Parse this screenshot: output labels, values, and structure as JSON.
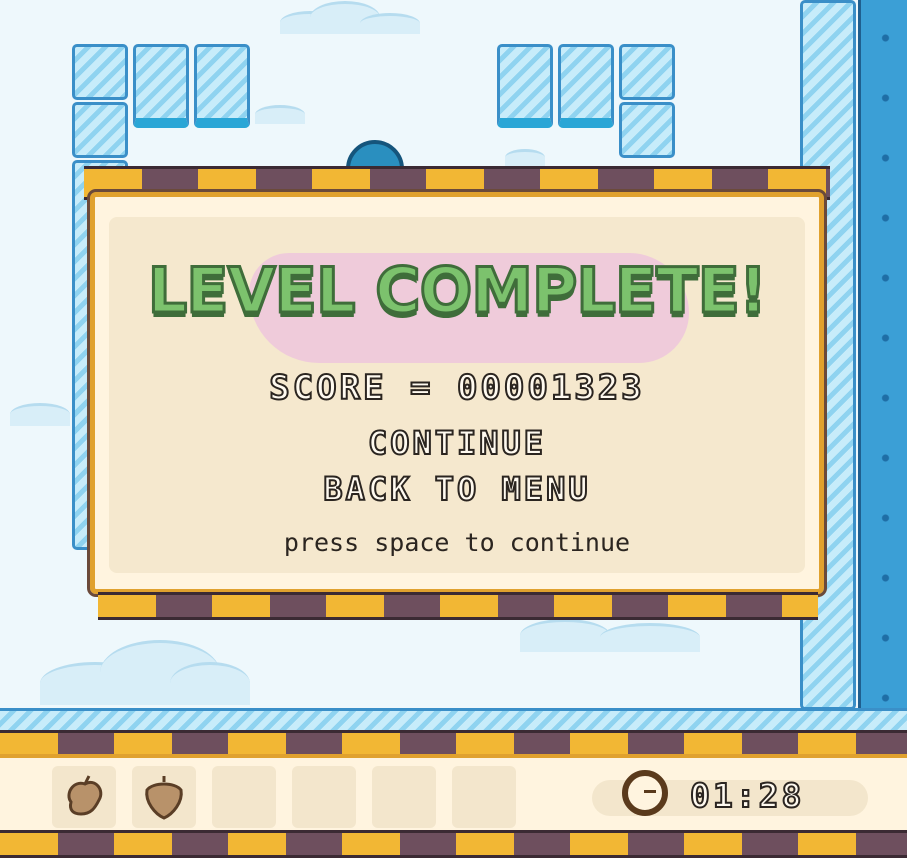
{
  "dialog": {
    "title": "LEVEL COMPLETE!",
    "score_label": "SCORE = 00001323",
    "continue_label": "CONTINUE",
    "menu_label": "BACK TO MENU",
    "hint": "press space to continue"
  },
  "hud": {
    "timer": "01:28",
    "slots": [
      {
        "name": "chicken-leg-icon",
        "filled": true
      },
      {
        "name": "acorn-icon",
        "filled": true
      },
      {
        "filled": false
      },
      {
        "filled": false
      },
      {
        "filled": false
      },
      {
        "filled": false
      }
    ]
  },
  "colors": {
    "title_green": "#7cc26d",
    "panel_gold": "#e0a12e",
    "stripe_dark": "#6e4f5e",
    "ice_blue": "#8fd3f0"
  }
}
